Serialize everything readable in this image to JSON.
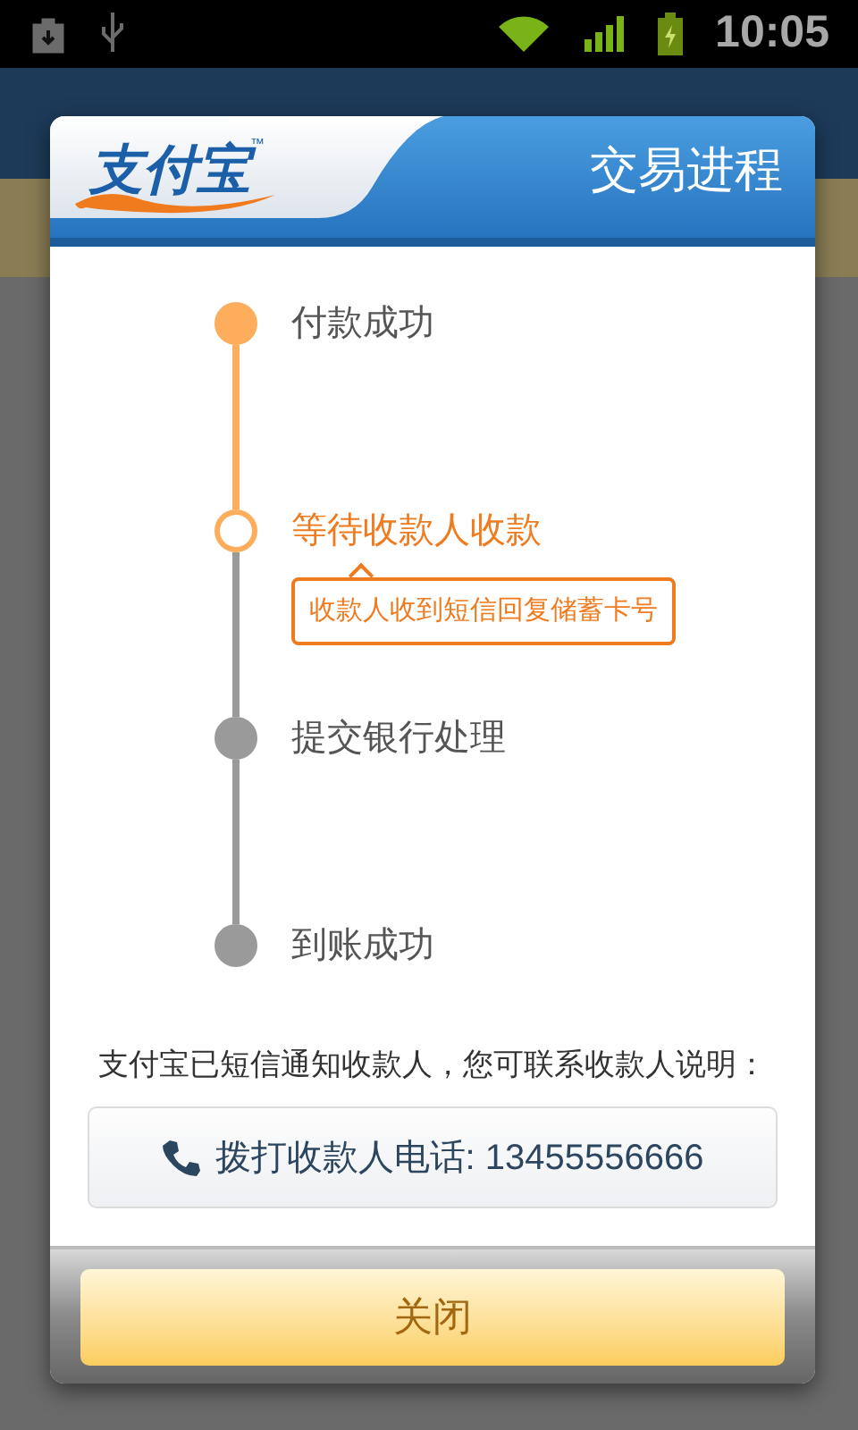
{
  "status_bar": {
    "time": "10:05"
  },
  "dialog": {
    "logo": {
      "text": "支付宝",
      "mark": "™"
    },
    "title": "交易进程",
    "steps": [
      {
        "label": "付款成功",
        "kind": "done"
      },
      {
        "label": "等待收款人收款",
        "kind": "current",
        "note": "收款人收到短信回复储蓄卡号"
      },
      {
        "label": "提交银行处理",
        "kind": "pending"
      },
      {
        "label": "到账成功",
        "kind": "pending"
      }
    ],
    "message": "支付宝已短信通知收款人，您可联系收款人说明：",
    "call_button": "拨打收款人电话: 13455556666",
    "close_button": "关闭"
  }
}
